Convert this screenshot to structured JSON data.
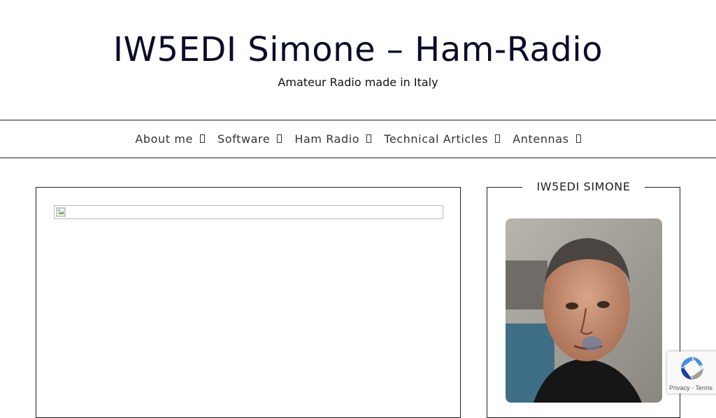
{
  "header": {
    "site_title": "IW5EDI Simone – Ham-Radio",
    "tagline": "Amateur Radio made in Italy"
  },
  "nav": {
    "items": [
      {
        "label": "About me",
        "icon": "chevron-down-icon"
      },
      {
        "label": "Software",
        "icon": "chevron-down-icon"
      },
      {
        "label": "Ham Radio",
        "icon": "chevron-down-icon"
      },
      {
        "label": "Technical Articles",
        "icon": "chevron-down-icon"
      },
      {
        "label": "Antennas",
        "icon": "chevron-down-icon"
      }
    ]
  },
  "main": {
    "featured_image_icon": "broken-image-icon"
  },
  "sidebar": {
    "widget_title": "IW5EDI SIMONE",
    "photo_icon": "profile-photo"
  },
  "recaptcha": {
    "privacy_label": "Privacy",
    "separator": " - ",
    "terms_label": "Terms",
    "icon": "recaptcha-logo-icon"
  },
  "colors": {
    "title": "#0b0b2a",
    "border": "#222222",
    "background": "#ffffff"
  }
}
